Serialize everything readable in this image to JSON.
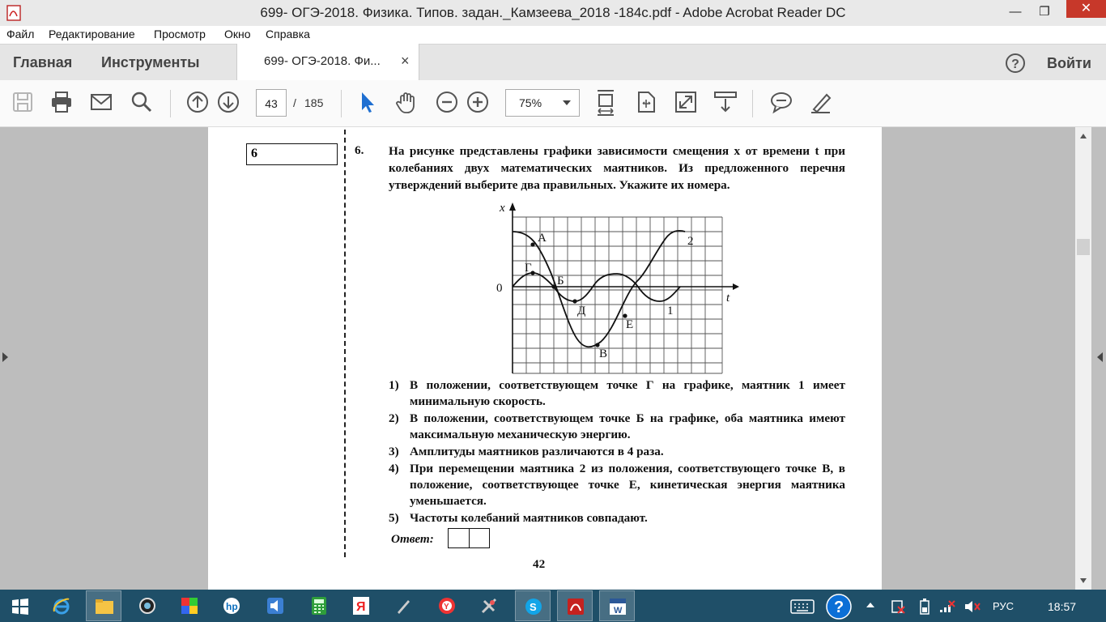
{
  "window": {
    "title": "699- ОГЭ-2018. Физика. Типов. задан._Камзеева_2018 -184с.pdf - Adobe Acrobat Reader DC"
  },
  "menu": [
    "Файл",
    "Редактирование",
    "Просмотр",
    "Окно",
    "Справка"
  ],
  "tabs": {
    "home": "Главная",
    "tools": "Инструменты",
    "document": "699- ОГЭ-2018. Фи...",
    "close_glyph": "×",
    "help_glyph": "?",
    "signin": "Войти"
  },
  "toolbar": {
    "page_current": "43",
    "page_separator": "/",
    "page_total": "185",
    "zoom": "75%"
  },
  "document": {
    "task_box_number": "6",
    "task_number": "6.",
    "question": "На рисунке представлены графики зависимости смещения x от времени t при колебаниях двух математических маятников. Из предложенного перечня утверждений выберите два правильных. Укажите их номера.",
    "graph": {
      "axis_x_label": "t",
      "axis_y_label": "x",
      "origin_label": "0",
      "curve_1_label": "1",
      "curve_2_label": "2",
      "points": {
        "A": "А",
        "G": "Г",
        "B": "Б",
        "D": "Д",
        "E": "Е",
        "V": "В"
      }
    },
    "options": [
      {
        "num": "1)",
        "text": "В положении, соответствующем точке Г на графике, маятник 1 имеет минимальную скорость."
      },
      {
        "num": "2)",
        "text": "В положении, соответствующем точке Б на графике, оба маятника имеют максимальную механическую энергию."
      },
      {
        "num": "3)",
        "text": "Амплитуды маятников различаются в 4 раза."
      },
      {
        "num": "4)",
        "text": "При перемещении маятника 2 из положения, соответствующего точке В, в положение, соответствующее точке Е, кинетическая энергия маятника уменьшается."
      },
      {
        "num": "5)",
        "text": "Частоты колебаний маятников совпадают."
      }
    ],
    "answer_label": "Ответ:",
    "page_number": "42"
  },
  "taskbar": {
    "language": "РУС",
    "time": "18:57"
  },
  "colors": {
    "taskbar": "#1f4f68",
    "close_button": "#c7382a",
    "cursor_tool": "#1f6fd1"
  }
}
